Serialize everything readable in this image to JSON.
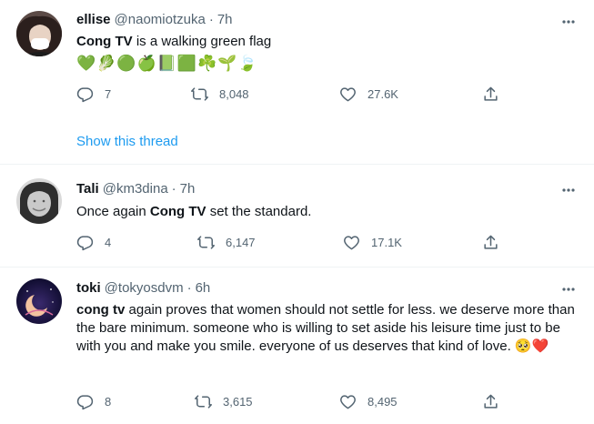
{
  "tweets": [
    {
      "name": "ellise",
      "handle": "@naomiotzuka",
      "time": "7h",
      "text_bold": "Cong TV",
      "text_rest": " is a walking green flag",
      "emojis": "💚🥬🟢🍏📗🟩☘️🌱🍃",
      "replies": "7",
      "retweets": "8,048",
      "likes": "27.6K",
      "show_thread": "Show this thread"
    },
    {
      "name": "Tali",
      "handle": "@km3dina",
      "time": "7h",
      "text_pre": "Once again ",
      "text_bold": "Cong TV",
      "text_rest": " set the standard.",
      "replies": "4",
      "retweets": "6,147",
      "likes": "17.1K"
    },
    {
      "name": "toki",
      "handle": "@tokyosdvm",
      "time": "6h",
      "text_bold": "cong tv",
      "text_rest": " again proves that women should not settle for less. we deserve more than the bare minimum. someone who is willing to set aside his leisure time just to be with you and make you smile. everyone of us deserves that kind of love. ",
      "emojis": "🥺❤️",
      "replies": "8",
      "retweets": "3,615",
      "likes": "8,495"
    }
  ],
  "colors": {
    "text": "#0f1419",
    "secondary": "#536471",
    "link": "#1d9bf0",
    "divider": "#eff3f4"
  }
}
